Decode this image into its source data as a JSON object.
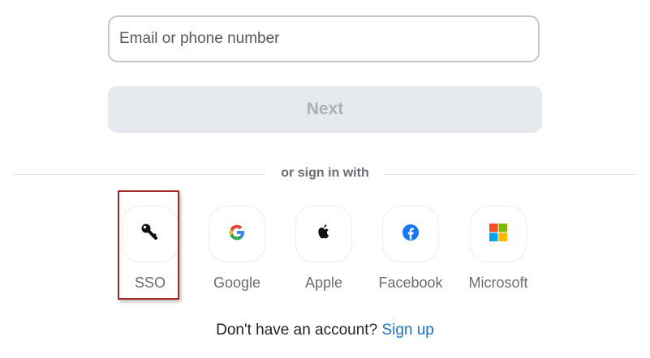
{
  "login": {
    "email_placeholder": "Email or phone number",
    "next_label": "Next"
  },
  "divider": {
    "label": "or sign in with"
  },
  "providers": [
    {
      "label": "SSO",
      "icon": "key-icon"
    },
    {
      "label": "Google",
      "icon": "google-icon"
    },
    {
      "label": "Apple",
      "icon": "apple-icon"
    },
    {
      "label": "Facebook",
      "icon": "facebook-icon"
    },
    {
      "label": "Microsoft",
      "icon": "microsoft-icon"
    }
  ],
  "signup": {
    "prompt": "Don't have an account?",
    "link_label": "Sign up"
  },
  "colors": {
    "focus_outline": "#a42828",
    "link": "#1a73c7",
    "next_disabled_bg": "#e6e9ed"
  }
}
